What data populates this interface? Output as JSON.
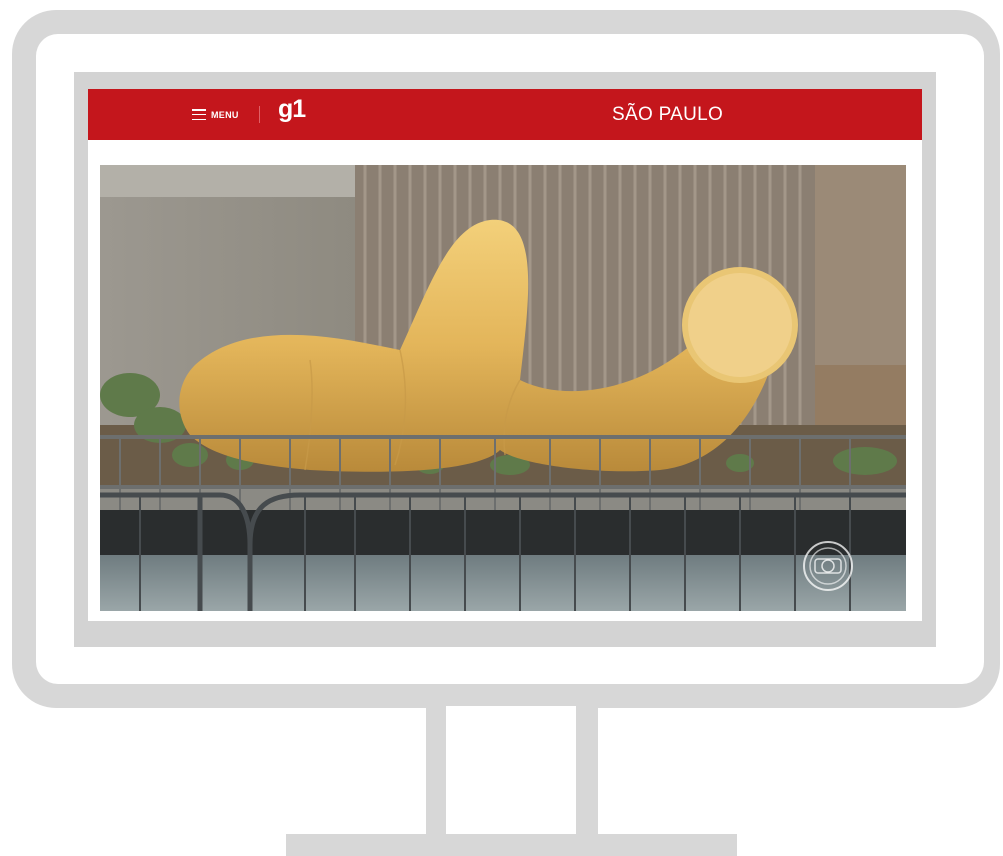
{
  "header": {
    "menu_label": "MENU",
    "logo_text": "g1",
    "section_title": "SÃO PAULO",
    "brand_color": "#c4161c"
  },
  "media": {
    "overlay_icon": "globo-logo-icon"
  },
  "icons": {
    "menu": "hamburger-icon"
  }
}
